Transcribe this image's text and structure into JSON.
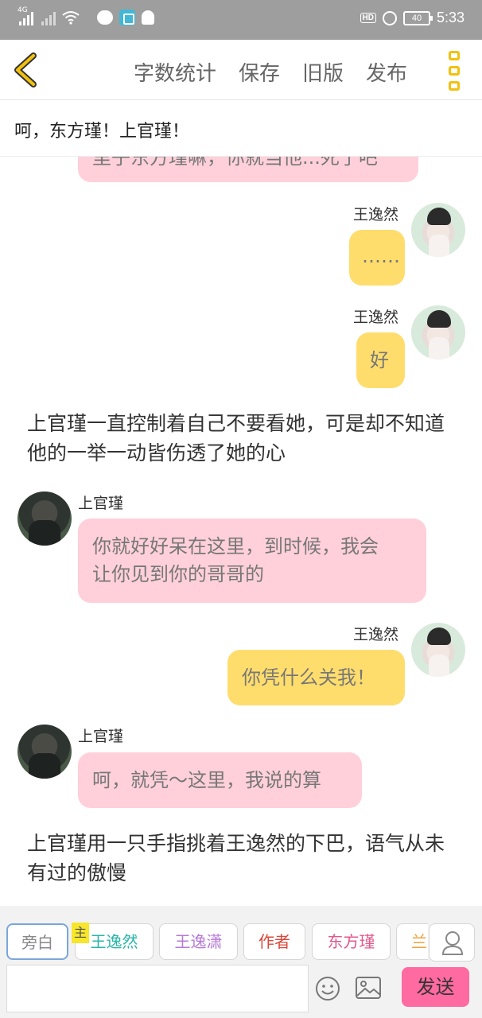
{
  "status": {
    "signal_tag": "4G",
    "battery": "40",
    "hd": "HD",
    "time": "5:33"
  },
  "header": {
    "menu": [
      "字数统计",
      "保存",
      "旧版",
      "发布"
    ]
  },
  "title": "呵，东方瑾！上官瑾！",
  "chat": {
    "top_partial": "里子东方瑾嘛，你就当他...死了吧",
    "messages": [
      {
        "speaker": "王逸然",
        "text": "……"
      },
      {
        "speaker": "王逸然",
        "text": "好"
      },
      {
        "narration": "上官瑾一直控制着自己不要看她，可是却不知道他的一举一动皆伤透了她的心"
      },
      {
        "speaker": "上官瑾",
        "text_line1": "你就好好呆在这里，到时候，我会",
        "text_line2": "让你见到你的哥哥的"
      },
      {
        "speaker": "王逸然",
        "text": "你凭什么关我！"
      },
      {
        "speaker": "上官瑾",
        "text": "呵，就凭～这里，我说的算"
      },
      {
        "narration": "上官瑾用一只手指挑着王逸然的下巴，语气从未有过的傲慢"
      }
    ]
  },
  "bottom": {
    "roles": [
      {
        "label": "旁白",
        "color": "#888888"
      },
      {
        "label": "王逸然",
        "color": "#2bb5a8"
      },
      {
        "label": "王逸潇",
        "color": "#b57ad6"
      },
      {
        "label": "作者",
        "color": "#d9483b"
      },
      {
        "label": "东方瑾",
        "color": "#e0588b"
      },
      {
        "label": "兰",
        "color": "#f2a23a"
      }
    ],
    "main_tag": "主",
    "send_label": "发送",
    "input_placeholder": ""
  }
}
